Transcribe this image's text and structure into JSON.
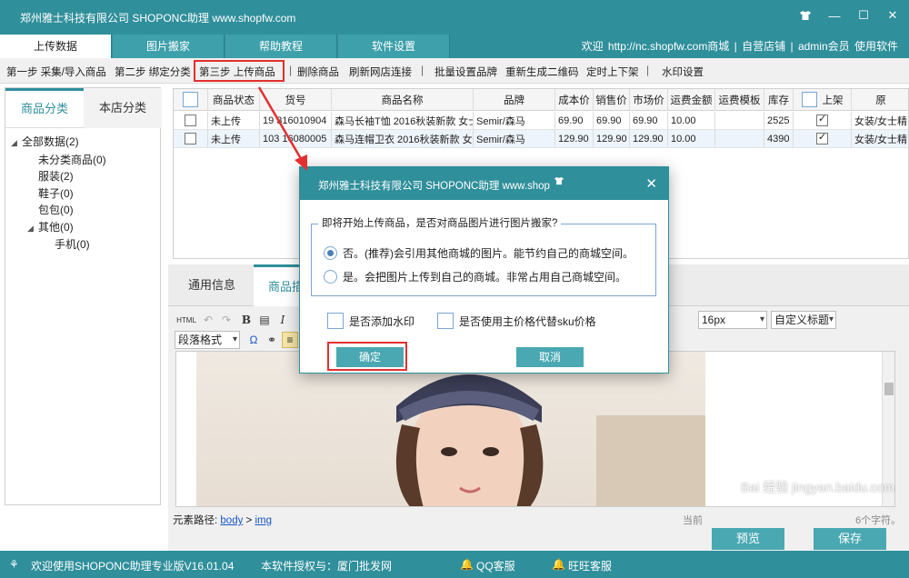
{
  "window": {
    "title": "郑州雅士科技有限公司 SHOPONC助理 www.shopfw.com",
    "shirt_icon": "tshirt-icon",
    "controls": [
      "minimize-icon",
      "maximize-icon",
      "close-icon"
    ]
  },
  "tabs": [
    {
      "label": "上传数据",
      "active": true
    },
    {
      "label": "图片搬家",
      "active": false
    },
    {
      "label": "帮助教程",
      "active": false
    },
    {
      "label": "软件设置",
      "active": false
    }
  ],
  "header_links": {
    "welcome": "欢迎",
    "url": "http://nc.shopfw.com商城",
    "sep1": "|",
    "my_shop": "自营店铺",
    "sep2": "|",
    "member": "admin会员",
    "use": "使用软件"
  },
  "toolbar": {
    "step1": "第一步 采集/导入商品",
    "step2": "第二步 绑定分类",
    "step3": "第三步 上传商品",
    "delete": "删除商品",
    "refresh": "刷新网店连接",
    "brand": "批量设置品牌",
    "qrcode": "重新生成二维码",
    "timer": "定时上下架",
    "watermark": "水印设置",
    "sep": "|"
  },
  "left_panel": {
    "tabs": [
      "商品分类",
      "本店分类"
    ],
    "tree": [
      {
        "label": "全部数据(2)",
        "level": 0,
        "expandable": true
      },
      {
        "label": "未分类商品(0)",
        "level": 1,
        "expandable": false
      },
      {
        "label": "服装(2)",
        "level": 1,
        "expandable": false
      },
      {
        "label": "鞋子(0)",
        "level": 1,
        "expandable": false
      },
      {
        "label": "包包(0)",
        "level": 1,
        "expandable": false
      },
      {
        "label": "其他(0)",
        "level": 1,
        "expandable": true
      },
      {
        "label": "手机(0)",
        "level": 2,
        "expandable": false
      }
    ]
  },
  "grid": {
    "columns": [
      "",
      "商品状态",
      "货号",
      "商品名称",
      "品牌",
      "成本价",
      "销售价",
      "市场价",
      "运费金额",
      "运费模板",
      "库存",
      "上架",
      "原"
    ],
    "rows": [
      {
        "status": "未上传",
        "sku": "19 316010904",
        "name": "森马长袖T恤 2016秋装新款 女士圆领",
        "brand": "Semir/森马",
        "cost": "69.90",
        "sale": "69.90",
        "market": "69.90",
        "freight": "10.00",
        "freight_tpl": "",
        "stock": "2525",
        "onsale": true,
        "source": "女装/女士精"
      },
      {
        "status": "未上传",
        "sku": "103 16080005",
        "name": "森马连帽卫衣 2016秋装新款 女士N",
        "brand": "Semir/森马",
        "cost": "129.90",
        "sale": "129.90",
        "market": "129.90",
        "freight": "10.00",
        "freight_tpl": "",
        "stock": "4390",
        "onsale": true,
        "source": "女装/女士精"
      }
    ]
  },
  "editor": {
    "tabs": [
      "通用信息",
      "商品描"
    ],
    "toolbar_icons": [
      "html-icon",
      "undo-icon",
      "redo-icon",
      "bold-icon",
      "format-icon",
      "italic-icon"
    ],
    "paragraph_format": "段落格式",
    "font_size": "16px",
    "custom_title": "自定义标题",
    "path_label": "元素路径:",
    "path_body": "body",
    "path_sep": ">",
    "path_img": "img",
    "preview_btn": "预览",
    "save_btn": "保存",
    "char_count_prefix": "当前",
    "char_count_suffix": "6个字符。"
  },
  "status": {
    "welcome": "欢迎使用SHOPONC助理专业版V16.01.04",
    "license": "本软件授权与：厦门批发网",
    "qq": "QQ客服",
    "wangwang": "旺旺客服"
  },
  "dialog": {
    "title": "郑州雅士科技有限公司 SHOPONC助理 www.shop",
    "legend": "即将开始上传商品，是否对商品图片进行图片搬家?",
    "option_no": "否。(推荐)会引用其他商城的图片。能节约自己的商城空间。",
    "option_yes": "是。会把图片上传到自己的商城。非常占用自己商城空间。",
    "selected": "no",
    "cb_watermark": "是否添加水印",
    "cb_main_price": "是否使用主价格代替sku价格",
    "ok": "确定",
    "cancel": "取消"
  },
  "watermark_text": "Bai 经验 jingyan.baidu.com",
  "colors": {
    "accent": "#2f8f9b",
    "button": "#4aa8b3",
    "annotation": "#e23030"
  }
}
